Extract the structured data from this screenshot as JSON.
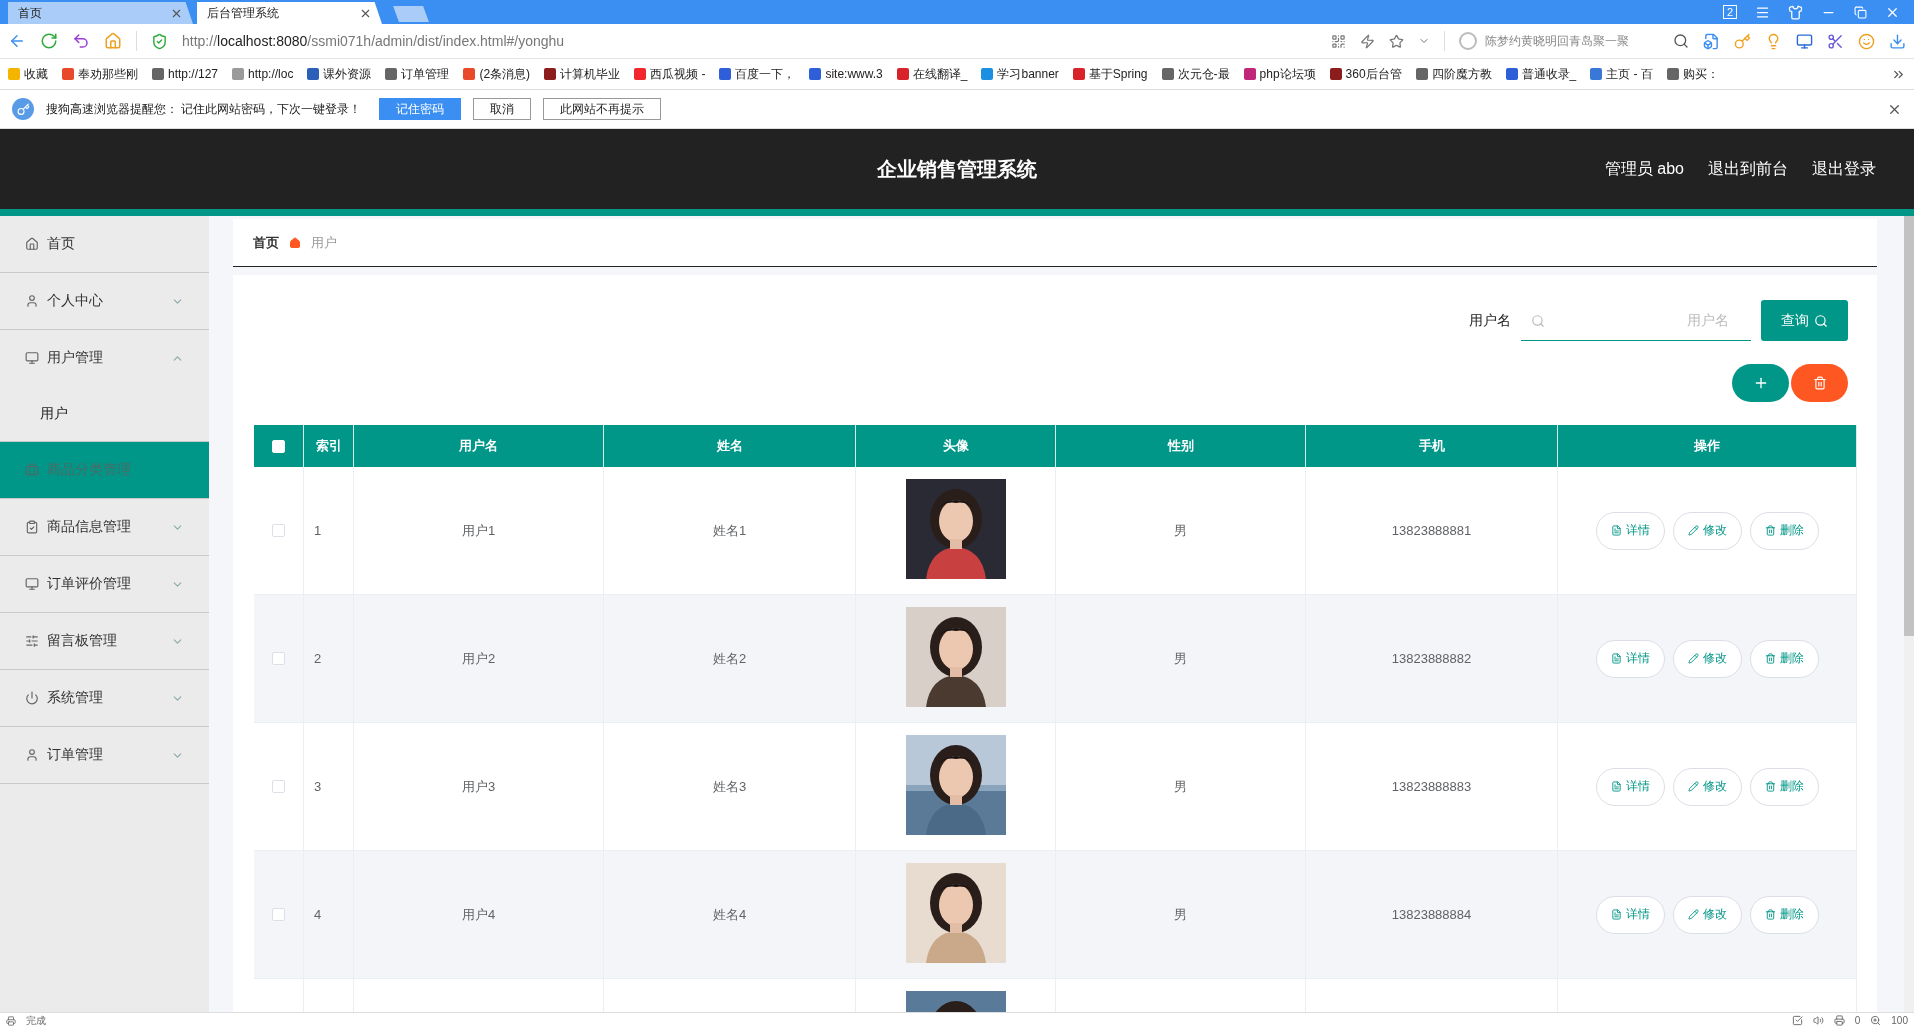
{
  "browser": {
    "tabs": [
      {
        "label": "首页",
        "selected": false
      },
      {
        "label": "后台管理系统",
        "selected": true
      }
    ],
    "window_badge": "2",
    "url": {
      "scheme": "http://",
      "host": "localhost:8080",
      "path": "/ssmi071h/admin/dist/index.html#/yonghu"
    },
    "search_placeholder": "陈梦约黄晓明回青岛聚一聚",
    "bookmarks": [
      {
        "label": "收藏",
        "color": "#f5b400"
      },
      {
        "label": "奉劝那些刚",
        "color": "#e8492b"
      },
      {
        "label": "http://127",
        "color": "#666666"
      },
      {
        "label": "http://loc",
        "color": "#9a9a9a"
      },
      {
        "label": "课外资源",
        "color": "#2b5fb8"
      },
      {
        "label": "订单管理",
        "color": "#666666"
      },
      {
        "label": "(2条消息)",
        "color": "#e8492b"
      },
      {
        "label": "计算机毕业",
        "color": "#8b1d1d"
      },
      {
        "label": "西瓜视频 -",
        "color": "#f2262f"
      },
      {
        "label": "百度一下，",
        "color": "#2e5fd8"
      },
      {
        "label": "site:www.3",
        "color": "#2e5fd8"
      },
      {
        "label": "在线翻译_",
        "color": "#d8232a"
      },
      {
        "label": "学习banner",
        "color": "#1d8fe0"
      },
      {
        "label": "基于Spring",
        "color": "#d8232a"
      },
      {
        "label": "次元仓-最",
        "color": "#666666"
      },
      {
        "label": "php论坛项",
        "color": "#c0267a"
      },
      {
        "label": "360后台管",
        "color": "#8b1d1d"
      },
      {
        "label": "四阶魔方教",
        "color": "#666666"
      },
      {
        "label": "普通收录_",
        "color": "#2e5fd8"
      },
      {
        "label": "主页 - 百",
        "color": "#3a78d8"
      },
      {
        "label": "购买：",
        "color": "#666666"
      }
    ],
    "notification": {
      "text": "搜狗高速浏览器提醒您： 记住此网站密码，下次一键登录！",
      "buttons": [
        "记住密码",
        "取消",
        "此网站不再提示"
      ]
    },
    "status": "完成",
    "status_count": "0",
    "zoom": "100"
  },
  "header": {
    "title": "企业销售管理系统",
    "user": "管理员 abo",
    "links": [
      "退出到前台",
      "退出登录"
    ]
  },
  "sidebar": {
    "items": [
      {
        "label": "首页",
        "selected": false
      },
      {
        "label": "个人中心",
        "selected": false,
        "expanded": false
      },
      {
        "label": "用户管理",
        "selected": false,
        "expanded": true,
        "children": [
          {
            "label": "用户",
            "selected": false
          }
        ]
      },
      {
        "label": "商品分类管理",
        "selected": true
      },
      {
        "label": "商品信息管理",
        "selected": false,
        "expanded": false
      },
      {
        "label": "订单评价管理",
        "selected": false,
        "expanded": false
      },
      {
        "label": "留言板管理",
        "selected": false,
        "expanded": false
      },
      {
        "label": "系统管理",
        "selected": false,
        "expanded": false
      },
      {
        "label": "订单管理",
        "selected": false,
        "expanded": false
      }
    ]
  },
  "breadcrumb": [
    "首页",
    "用户"
  ],
  "search": {
    "label": "用户名",
    "placeholder": "用户名",
    "button": "查询"
  },
  "table": {
    "select_all": {
      "checked": false
    },
    "columns": [
      "索引",
      "用户名",
      "姓名",
      "头像",
      "性别",
      "手机",
      "操作"
    ],
    "rows": [
      {
        "checked": false,
        "index": "1",
        "username": "用户1",
        "name": "姓名1",
        "avatar": {
          "kind": "picture"
        },
        "gender": "男",
        "phone": "13823888881",
        "actions": [
          "详情",
          "修改",
          "删除"
        ]
      },
      {
        "checked": false,
        "index": "2",
        "username": "用户2",
        "name": "姓名2",
        "avatar": {
          "kind": "picture"
        },
        "gender": "男",
        "phone": "13823888882",
        "actions": [
          "详情",
          "修改",
          "删除"
        ]
      },
      {
        "checked": false,
        "index": "3",
        "username": "用户3",
        "name": "姓名3",
        "avatar": {
          "kind": "picture"
        },
        "gender": "男",
        "phone": "13823888883",
        "actions": [
          "详情",
          "修改",
          "删除"
        ]
      },
      {
        "checked": false,
        "index": "4",
        "username": "用户4",
        "name": "姓名4",
        "avatar": {
          "kind": "picture"
        },
        "gender": "男",
        "phone": "13823888884",
        "actions": [
          "详情",
          "修改",
          "删除"
        ]
      },
      {
        "avatar": {
          "kind": "picture"
        }
      }
    ]
  }
}
